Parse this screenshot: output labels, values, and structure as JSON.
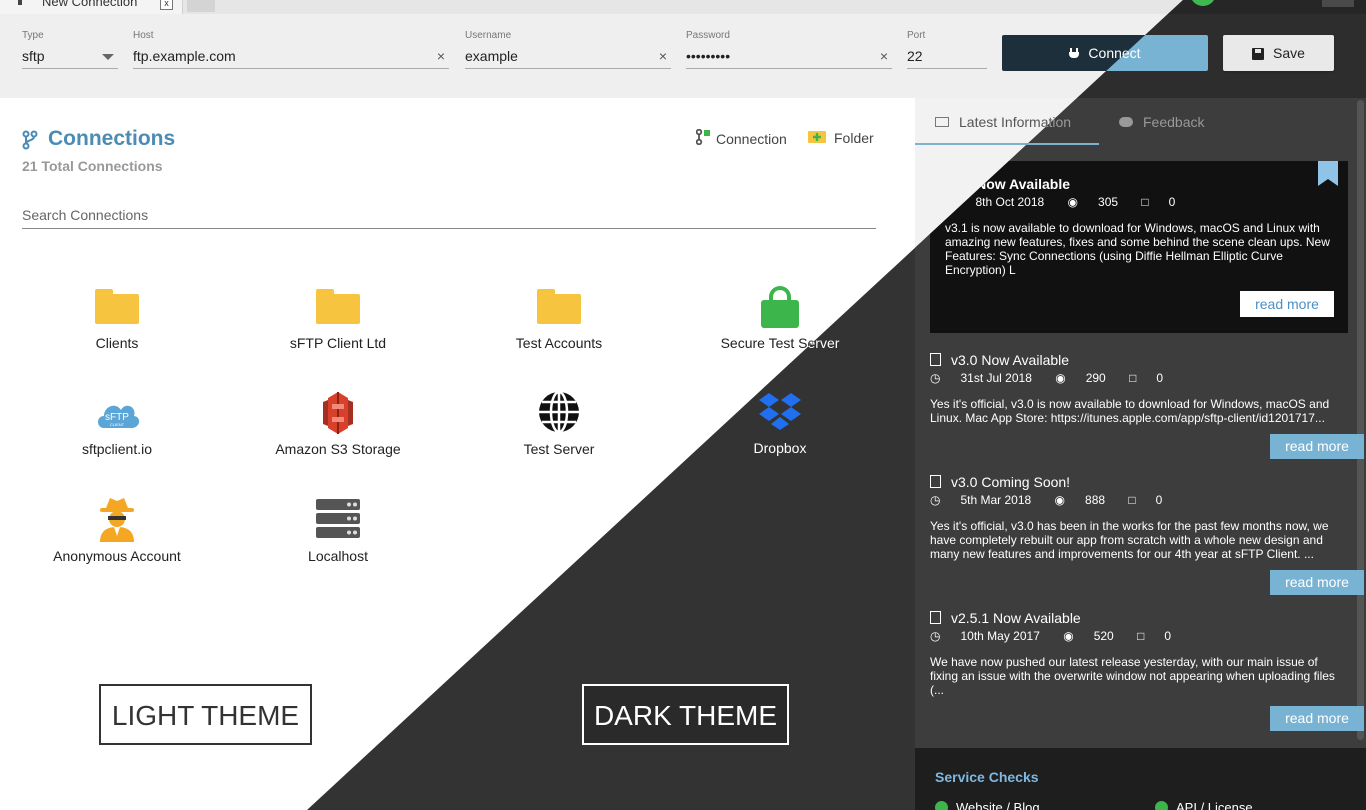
{
  "tab": {
    "title": "New Connection",
    "close": "x"
  },
  "connection": {
    "type_label": "Type",
    "type_value": "sftp",
    "host_label": "Host",
    "host_value": "ftp.example.com",
    "username_label": "Username",
    "username_value": "example",
    "password_label": "Password",
    "password_value": "•••••••••",
    "port_label": "Port",
    "port_value": "22",
    "clear": "×",
    "connect_label": "Connect",
    "save_label": "Save"
  },
  "connections": {
    "title": "Connections",
    "subtitle": "21 Total Connections",
    "add_connection": "Connection",
    "add_folder": "Folder",
    "search_placeholder": "Search Connections",
    "items": [
      {
        "label": "Clients",
        "icon": "folder-icon"
      },
      {
        "label": "sFTP Client Ltd",
        "icon": "folder-icon"
      },
      {
        "label": "Test Accounts",
        "icon": "folder-icon"
      },
      {
        "label": "Secure Test Server",
        "icon": "lock-icon"
      },
      {
        "label": "sftpclient.io",
        "icon": "cloud-icon"
      },
      {
        "label": "Amazon S3 Storage",
        "icon": "aws-s3-icon"
      },
      {
        "label": "Test Server",
        "icon": "globe-icon"
      },
      {
        "label": "Dropbox",
        "icon": "dropbox-icon"
      },
      {
        "label": "Anonymous Account",
        "icon": "spy-icon"
      },
      {
        "label": "Localhost",
        "icon": "server-icon"
      }
    ],
    "cloud_text": "sFTP",
    "cloud_subtext": "CLIENT"
  },
  "themes": {
    "light": "LIGHT THEME",
    "dark": "DARK THEME"
  },
  "panel": {
    "tab_info": "Latest Information",
    "tab_feedback": "Feedback",
    "featured": {
      "title": "v3.1 Now Available",
      "date": "8th Oct 2018",
      "views": "305",
      "comments": "0",
      "body": "v3.1 is now available to download for Windows, macOS and Linux with amazing new features, fixes and some behind the scene clean ups. New Features: Sync Connections (using Diffie Hellman Elliptic Curve Encryption) L",
      "read_more": "read more"
    },
    "news": [
      {
        "title": "v3.0 Now Available",
        "date": "31st Jul 2018",
        "views": "290",
        "comments": "0",
        "body": "Yes it's official, v3.0 is now available to download for Windows, macOS and Linux. Mac App Store: https://itunes.apple.com/app/sftp-client/id1201717...",
        "read_more": "read more"
      },
      {
        "title": "v3.0 Coming Soon!",
        "date": "5th Mar 2018",
        "views": "888",
        "comments": "0",
        "body": "Yes it's official, v3.0 has been in the works for the past few months now, we have completely rebuilt our app from scratch with a whole new design and many new features and improvements for our 4th year at sFTP Client. ...",
        "read_more": "read more"
      },
      {
        "title": "v2.5.1 Now Available",
        "date": "10th May 2017",
        "views": "520",
        "comments": "0",
        "body": "We have now pushed our latest release yesterday, with our main issue of fixing an issue with the overwrite window not appearing when uploading files (...",
        "read_more": "read more"
      }
    ],
    "service_title": "Service Checks",
    "services": [
      "Website / Blog",
      "API / License"
    ]
  },
  "colors": {
    "accent": "#4a8cb4",
    "folder": "#f7c43f",
    "lock": "#3cb64a",
    "dark_bg": "#333333",
    "read_more": "#79b3d4"
  }
}
